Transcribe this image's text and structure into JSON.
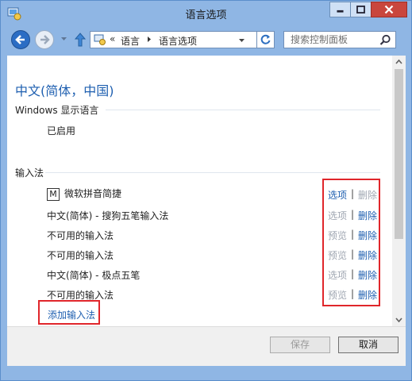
{
  "window": {
    "title": "语言选项"
  },
  "address": {
    "chevron": "«",
    "crumbs": [
      "语言",
      "语言选项"
    ]
  },
  "search": {
    "placeholder": "搜索控制面板"
  },
  "page": {
    "heading": "中文(简体，中国)",
    "display_section_label": "Windows 显示语言",
    "display_status": "已启用",
    "ime_section_label": "输入法",
    "ime_items": [
      {
        "icon_text": "M",
        "name": "微软拼音简捷",
        "action1": "选项",
        "action1_enabled": true,
        "action2": "删除",
        "action2_enabled": false
      },
      {
        "icon_text": "",
        "name": "中文(简体) - 搜狗五笔输入法",
        "action1": "选项",
        "action1_enabled": false,
        "action2": "删除",
        "action2_enabled": true
      },
      {
        "icon_text": "",
        "name": "不可用的输入法",
        "action1": "预览",
        "action1_enabled": false,
        "action2": "删除",
        "action2_enabled": true
      },
      {
        "icon_text": "",
        "name": "不可用的输入法",
        "action1": "预览",
        "action1_enabled": false,
        "action2": "删除",
        "action2_enabled": true
      },
      {
        "icon_text": "",
        "name": "中文(简体) - 极点五笔",
        "action1": "选项",
        "action1_enabled": false,
        "action2": "删除",
        "action2_enabled": true
      },
      {
        "icon_text": "",
        "name": "不可用的输入法",
        "action1": "预览",
        "action1_enabled": false,
        "action2": "删除",
        "action2_enabled": true
      }
    ],
    "pipe": "|",
    "add_ime_link": "添加输入法"
  },
  "footer": {
    "save_label": "保存",
    "cancel_label": "取消"
  },
  "colors": {
    "frame": "#8fb6e4",
    "link": "#1e5fb0",
    "disabled": "#a0a7b2",
    "highlight": "#e0262b",
    "close": "#c9463d"
  },
  "icons": [
    "control-panel-icon",
    "minimize-icon",
    "maximize-icon",
    "close-icon",
    "back-arrow-icon",
    "forward-arrow-icon",
    "up-arrow-icon",
    "refresh-icon",
    "search-icon"
  ]
}
